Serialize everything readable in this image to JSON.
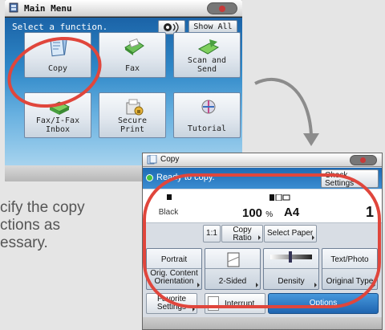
{
  "main_menu": {
    "title": "Main Menu",
    "prompt": "Select a function.",
    "show_all_label": "Show All",
    "tiles": {
      "copy": "Copy",
      "fax": "Fax",
      "scan_send": "Scan and\nSend",
      "fax_ifax_inbox": "Fax/I-Fax\nInbox",
      "secure_print": "Secure\nPrint",
      "tutorial": "Tutorial"
    }
  },
  "side_text": "cify the copy\nctions as\nessary.",
  "copy_screen": {
    "title": "Copy",
    "status": "Ready to copy.",
    "check_settings": "Check\nSettings",
    "color_mode": "Black",
    "ratio_value": "100",
    "ratio_unit": "%",
    "paper": "A4",
    "quantity": "1",
    "one_to_one": "1:1",
    "copy_ratio": "Copy\nRatio",
    "select_paper": "Select Paper",
    "orientation_value": "Portrait",
    "orientation_label": "Orig. Content\nOrientation",
    "two_sided": "2-Sided",
    "density": "Density",
    "type_value": "Text/Photo",
    "type_label": "Original Type",
    "favorite": "Favorite\nSettings",
    "interrupt": "Interrupt",
    "options": "Options"
  },
  "colors": {
    "highlight": "#e0463c",
    "status_blue": "#2a7cc4",
    "sky_blue": "#2f88c8"
  }
}
